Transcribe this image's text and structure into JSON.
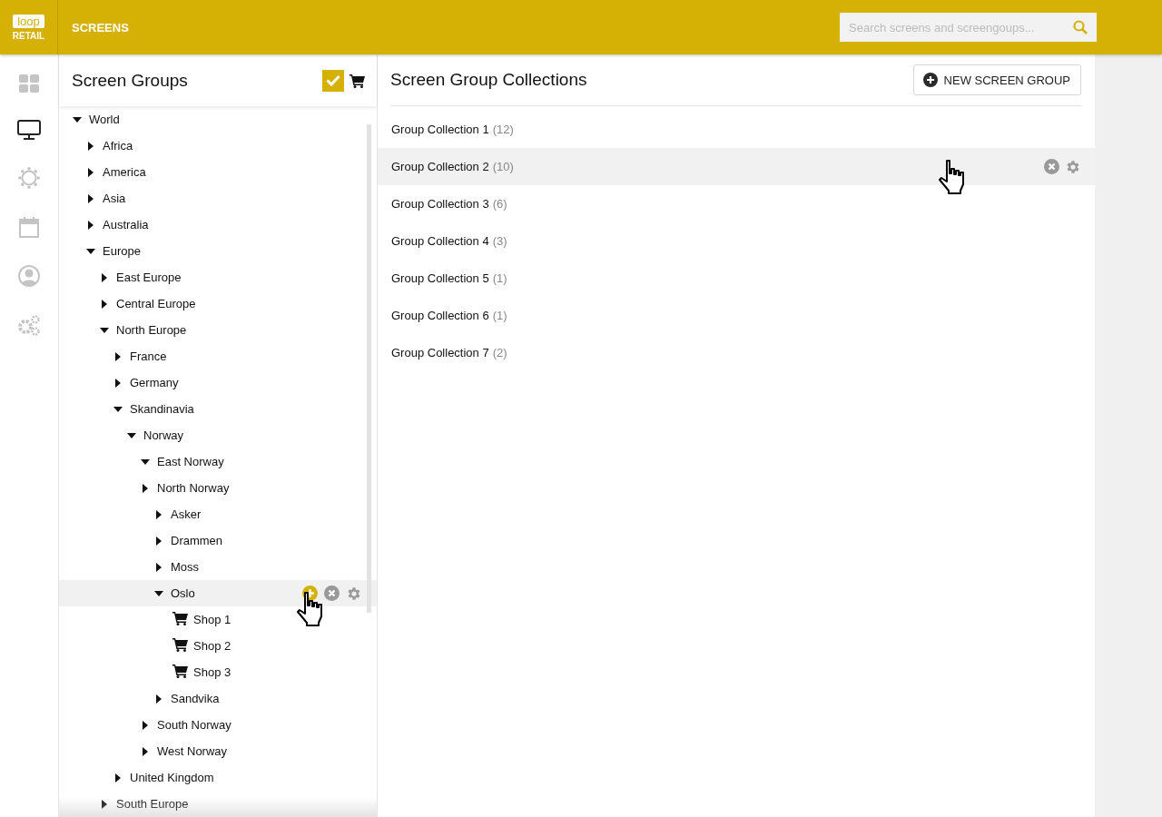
{
  "header": {
    "logo_top": "loop",
    "logo_bottom": "RETAIL",
    "section": "SCREENS",
    "search": {
      "placeholder": "Search screens and screengoups..."
    }
  },
  "nav": [
    {
      "kind": "dashboard",
      "selected": false
    },
    {
      "kind": "monitor",
      "selected": true
    },
    {
      "kind": "sun",
      "selected": false
    },
    {
      "kind": "calendar",
      "selected": false
    },
    {
      "kind": "user",
      "selected": false
    },
    {
      "kind": "gears",
      "selected": false
    }
  ],
  "screen_groups": {
    "title": "Screen Groups",
    "select_all_checked": true,
    "tree": [
      {
        "label": "World",
        "kind": "folder",
        "expanded": true,
        "children": [
          {
            "label": "Africa",
            "kind": "folder",
            "expanded": false
          },
          {
            "label": "America",
            "kind": "folder",
            "expanded": false
          },
          {
            "label": "Asia",
            "kind": "folder",
            "expanded": false
          },
          {
            "label": "Australia",
            "kind": "folder",
            "expanded": false
          },
          {
            "label": "Europe",
            "kind": "folder",
            "expanded": true,
            "children": [
              {
                "label": "East Europe",
                "kind": "folder",
                "expanded": false
              },
              {
                "label": "Central Europe",
                "kind": "folder",
                "expanded": false
              },
              {
                "label": "North Europe",
                "kind": "folder",
                "expanded": true,
                "children": [
                  {
                    "label": "France",
                    "kind": "folder",
                    "expanded": false
                  },
                  {
                    "label": "Germany",
                    "kind": "folder",
                    "expanded": false
                  },
                  {
                    "label": "Skandinavia",
                    "kind": "folder",
                    "expanded": true,
                    "children": [
                      {
                        "label": "Norway",
                        "kind": "folder",
                        "expanded": true,
                        "children": [
                          {
                            "label": "East Norway",
                            "kind": "folder",
                            "expanded": true
                          },
                          {
                            "label": "North Norway",
                            "kind": "folder",
                            "expanded": false,
                            "children": [
                              {
                                "label": "Asker",
                                "kind": "folder",
                                "expanded": false
                              },
                              {
                                "label": "Drammen",
                                "kind": "folder",
                                "expanded": false
                              },
                              {
                                "label": "Moss",
                                "kind": "folder",
                                "expanded": false
                              },
                              {
                                "label": "Oslo",
                                "kind": "folder",
                                "expanded": true,
                                "hovered": true,
                                "children": [
                                  {
                                    "label": "Shop 1",
                                    "kind": "shop"
                                  },
                                  {
                                    "label": "Shop 2",
                                    "kind": "shop"
                                  },
                                  {
                                    "label": "Shop 3",
                                    "kind": "shop"
                                  }
                                ]
                              },
                              {
                                "label": "Sandvika",
                                "kind": "folder",
                                "expanded": false
                              }
                            ]
                          },
                          {
                            "label": "South Norway",
                            "kind": "folder",
                            "expanded": false
                          },
                          {
                            "label": "West Norway",
                            "kind": "folder",
                            "expanded": false
                          }
                        ]
                      }
                    ]
                  },
                  {
                    "label": "United Kingdom",
                    "kind": "folder",
                    "expanded": false
                  }
                ]
              },
              {
                "label": "South Europe",
                "kind": "folder",
                "expanded": false
              }
            ]
          }
        ]
      }
    ]
  },
  "collections": {
    "title": "Screen Group Collections",
    "new_button": "NEW SCREEN GROUP",
    "items": [
      {
        "name": "Group Collection 1",
        "count": "(12)",
        "hovered": false
      },
      {
        "name": "Group Collection 2",
        "count": "(10)",
        "hovered": true
      },
      {
        "name": "Group Collection 3",
        "count": "(6)",
        "hovered": false
      },
      {
        "name": "Group Collection 4",
        "count": "(3)",
        "hovered": false
      },
      {
        "name": "Group Collection 5",
        "count": "(1)",
        "hovered": false
      },
      {
        "name": "Group Collection 6",
        "count": "(1)",
        "hovered": false
      },
      {
        "name": "Group Collection 7",
        "count": "(2)",
        "hovered": false
      }
    ]
  }
}
